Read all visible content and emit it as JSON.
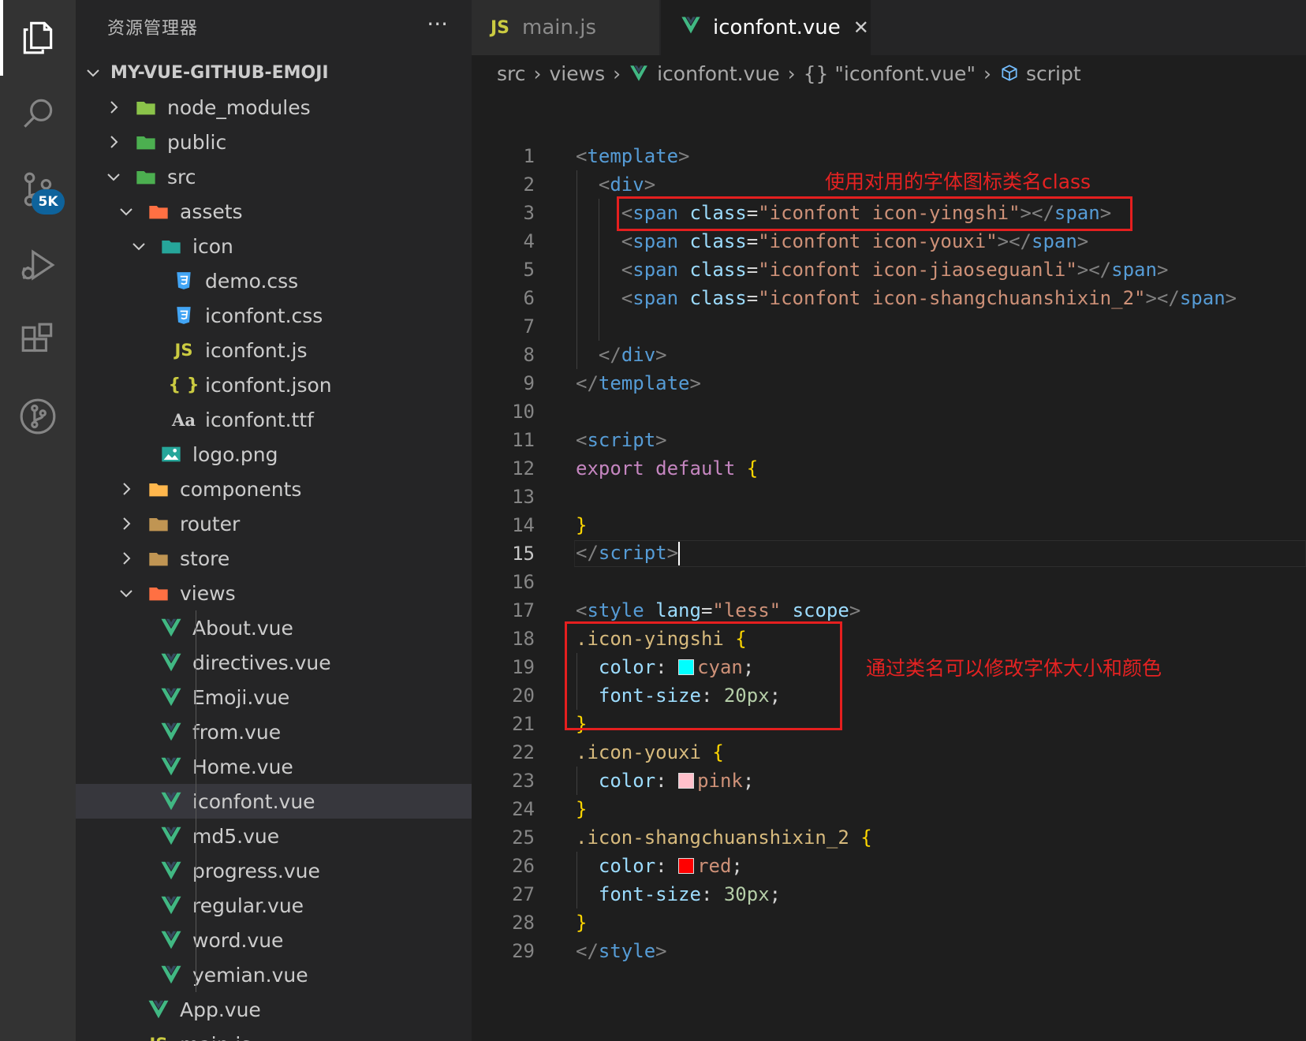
{
  "activity_bar": {
    "items": [
      "explorer-icon",
      "search-icon",
      "source-control-icon",
      "run-debug-icon",
      "extensions-icon",
      "git-graph-icon"
    ],
    "badge": "5K"
  },
  "sidebar": {
    "title": "资源管理器",
    "more": "···",
    "root": "MY-VUE-GITHUB-EMOJI",
    "tree": [
      {
        "label": "node_modules",
        "type": "folder",
        "expanded": false,
        "depth": 1
      },
      {
        "label": "public",
        "type": "folder",
        "expanded": false,
        "depth": 1
      },
      {
        "label": "src",
        "type": "folder",
        "expanded": true,
        "depth": 1
      },
      {
        "label": "assets",
        "type": "folder",
        "expanded": true,
        "depth": 2
      },
      {
        "label": "icon",
        "type": "folder",
        "expanded": true,
        "depth": 3
      },
      {
        "label": "demo.css",
        "type": "css",
        "depth": 4
      },
      {
        "label": "iconfont.css",
        "type": "css",
        "depth": 4
      },
      {
        "label": "iconfont.js",
        "type": "js",
        "depth": 4
      },
      {
        "label": "iconfont.json",
        "type": "json",
        "depth": 4
      },
      {
        "label": "iconfont.ttf",
        "type": "font",
        "depth": 4
      },
      {
        "label": "logo.png",
        "type": "image",
        "depth": 3
      },
      {
        "label": "components",
        "type": "folder",
        "expanded": false,
        "depth": 2
      },
      {
        "label": "router",
        "type": "folder",
        "expanded": false,
        "depth": 2
      },
      {
        "label": "store",
        "type": "folder",
        "expanded": false,
        "depth": 2
      },
      {
        "label": "views",
        "type": "folder",
        "expanded": true,
        "depth": 2
      },
      {
        "label": "About.vue",
        "type": "vue",
        "depth": 3
      },
      {
        "label": "directives.vue",
        "type": "vue",
        "depth": 3
      },
      {
        "label": "Emoji.vue",
        "type": "vue",
        "depth": 3
      },
      {
        "label": "from.vue",
        "type": "vue",
        "depth": 3
      },
      {
        "label": "Home.vue",
        "type": "vue",
        "depth": 3
      },
      {
        "label": "iconfont.vue",
        "type": "vue",
        "depth": 3,
        "selected": true
      },
      {
        "label": "md5.vue",
        "type": "vue",
        "depth": 3
      },
      {
        "label": "progress.vue",
        "type": "vue",
        "depth": 3
      },
      {
        "label": "regular.vue",
        "type": "vue",
        "depth": 3
      },
      {
        "label": "word.vue",
        "type": "vue",
        "depth": 3
      },
      {
        "label": "yemian.vue",
        "type": "vue",
        "depth": 3
      },
      {
        "label": "App.vue",
        "type": "vue",
        "depth": 2
      },
      {
        "label": "main.js",
        "type": "js",
        "depth": 2
      }
    ]
  },
  "tabs": [
    {
      "icon": "JS",
      "label": "main.js",
      "active": false
    },
    {
      "icon": "V",
      "label": "iconfont.vue",
      "active": true,
      "close": "✕"
    }
  ],
  "breadcrumb": [
    "src",
    "views",
    "iconfont.vue",
    "{} \"iconfont.vue\"",
    "script"
  ],
  "editor": {
    "current_line": 15,
    "lines": [
      [
        [
          "t-punc",
          "<"
        ],
        [
          "t-tag",
          "template"
        ],
        [
          "t-punc",
          ">"
        ]
      ],
      [
        [
          "t-white",
          "  "
        ],
        [
          "t-punc",
          "<"
        ],
        [
          "t-tag",
          "div"
        ],
        [
          "t-punc",
          ">"
        ]
      ],
      [
        [
          "t-white",
          "    "
        ],
        [
          "t-punc",
          "<"
        ],
        [
          "t-tag",
          "span"
        ],
        [
          "t-white",
          " "
        ],
        [
          "t-attr",
          "class"
        ],
        [
          "t-white",
          "="
        ],
        [
          "t-str",
          "\"iconfont icon-yingshi\""
        ],
        [
          "t-punc",
          "></"
        ],
        [
          "t-tag",
          "span"
        ],
        [
          "t-punc",
          ">"
        ]
      ],
      [
        [
          "t-white",
          "    "
        ],
        [
          "t-punc",
          "<"
        ],
        [
          "t-tag",
          "span"
        ],
        [
          "t-white",
          " "
        ],
        [
          "t-attr",
          "class"
        ],
        [
          "t-white",
          "="
        ],
        [
          "t-str",
          "\"iconfont icon-youxi\""
        ],
        [
          "t-punc",
          "></"
        ],
        [
          "t-tag",
          "span"
        ],
        [
          "t-punc",
          ">"
        ]
      ],
      [
        [
          "t-white",
          "    "
        ],
        [
          "t-punc",
          "<"
        ],
        [
          "t-tag",
          "span"
        ],
        [
          "t-white",
          " "
        ],
        [
          "t-attr",
          "class"
        ],
        [
          "t-white",
          "="
        ],
        [
          "t-str",
          "\"iconfont icon-jiaoseguanli\""
        ],
        [
          "t-punc",
          "></"
        ],
        [
          "t-tag",
          "span"
        ],
        [
          "t-punc",
          ">"
        ]
      ],
      [
        [
          "t-white",
          "    "
        ],
        [
          "t-punc",
          "<"
        ],
        [
          "t-tag",
          "span"
        ],
        [
          "t-white",
          " "
        ],
        [
          "t-attr",
          "class"
        ],
        [
          "t-white",
          "="
        ],
        [
          "t-str",
          "\"iconfont icon-shangchuanshixin_2\""
        ],
        [
          "t-punc",
          "></"
        ],
        [
          "t-tag",
          "span"
        ],
        [
          "t-punc",
          ">"
        ]
      ],
      [],
      [
        [
          "t-white",
          "  "
        ],
        [
          "t-punc",
          "</"
        ],
        [
          "t-tag",
          "div"
        ],
        [
          "t-punc",
          ">"
        ]
      ],
      [
        [
          "t-punc",
          "</"
        ],
        [
          "t-tag",
          "template"
        ],
        [
          "t-punc",
          ">"
        ]
      ],
      [],
      [
        [
          "t-punc",
          "<"
        ],
        [
          "t-tag",
          "script"
        ],
        [
          "t-punc",
          ">"
        ]
      ],
      [
        [
          "t-kw",
          "export"
        ],
        [
          "t-white",
          " "
        ],
        [
          "t-kw",
          "default"
        ],
        [
          "t-white",
          " "
        ],
        [
          "t-brace",
          "{"
        ]
      ],
      [],
      [
        [
          "t-brace",
          "}"
        ]
      ],
      [
        [
          "t-punc",
          "</"
        ],
        [
          "t-tag",
          "script"
        ],
        [
          "t-punc",
          ">"
        ]
      ],
      [],
      [
        [
          "t-punc",
          "<"
        ],
        [
          "t-tag",
          "style"
        ],
        [
          "t-white",
          " "
        ],
        [
          "t-attr",
          "lang"
        ],
        [
          "t-white",
          "="
        ],
        [
          "t-str",
          "\"less\""
        ],
        [
          "t-white",
          " "
        ],
        [
          "t-attr",
          "scope"
        ],
        [
          "t-punc",
          ">"
        ]
      ],
      [
        [
          "t-sel",
          ".icon-yingshi"
        ],
        [
          "t-white",
          " "
        ],
        [
          "t-brace",
          "{"
        ]
      ],
      [
        [
          "t-white",
          "  "
        ],
        [
          "t-prop",
          "color"
        ],
        [
          "t-white",
          ": "
        ],
        [
          "swatch",
          "#00ffff"
        ],
        [
          "t-str",
          "cyan"
        ],
        [
          "t-white",
          ";"
        ]
      ],
      [
        [
          "t-white",
          "  "
        ],
        [
          "t-prop",
          "font-size"
        ],
        [
          "t-white",
          ": "
        ],
        [
          "t-num",
          "20px"
        ],
        [
          "t-white",
          ";"
        ]
      ],
      [
        [
          "t-brace",
          "}"
        ]
      ],
      [
        [
          "t-sel",
          ".icon-youxi"
        ],
        [
          "t-white",
          " "
        ],
        [
          "t-brace",
          "{"
        ]
      ],
      [
        [
          "t-white",
          "  "
        ],
        [
          "t-prop",
          "color"
        ],
        [
          "t-white",
          ": "
        ],
        [
          "swatch",
          "#ffc0cb"
        ],
        [
          "t-str",
          "pink"
        ],
        [
          "t-white",
          ";"
        ]
      ],
      [
        [
          "t-brace",
          "}"
        ]
      ],
      [
        [
          "t-sel",
          ".icon-shangchuanshixin_2"
        ],
        [
          "t-white",
          " "
        ],
        [
          "t-brace",
          "{"
        ]
      ],
      [
        [
          "t-white",
          "  "
        ],
        [
          "t-prop",
          "color"
        ],
        [
          "t-white",
          ": "
        ],
        [
          "swatch",
          "#ff0000"
        ],
        [
          "t-str",
          "red"
        ],
        [
          "t-white",
          ";"
        ]
      ],
      [
        [
          "t-white",
          "  "
        ],
        [
          "t-prop",
          "font-size"
        ],
        [
          "t-white",
          ": "
        ],
        [
          "t-num",
          "30px"
        ],
        [
          "t-white",
          ";"
        ]
      ],
      [
        [
          "t-brace",
          "}"
        ]
      ],
      [
        [
          "t-punc",
          "</"
        ],
        [
          "t-tag",
          "style"
        ],
        [
          "t-punc",
          ">"
        ]
      ]
    ]
  },
  "annotations": {
    "top": "使用对用的字体图标类名class",
    "bottom": "通过类名可以修改字体大小和颜色"
  },
  "colors": {
    "vue_green": "#41b883",
    "js_yellow": "#cbcb41",
    "css_blue": "#42a5f5",
    "annotation_red": "#e51f1f"
  }
}
